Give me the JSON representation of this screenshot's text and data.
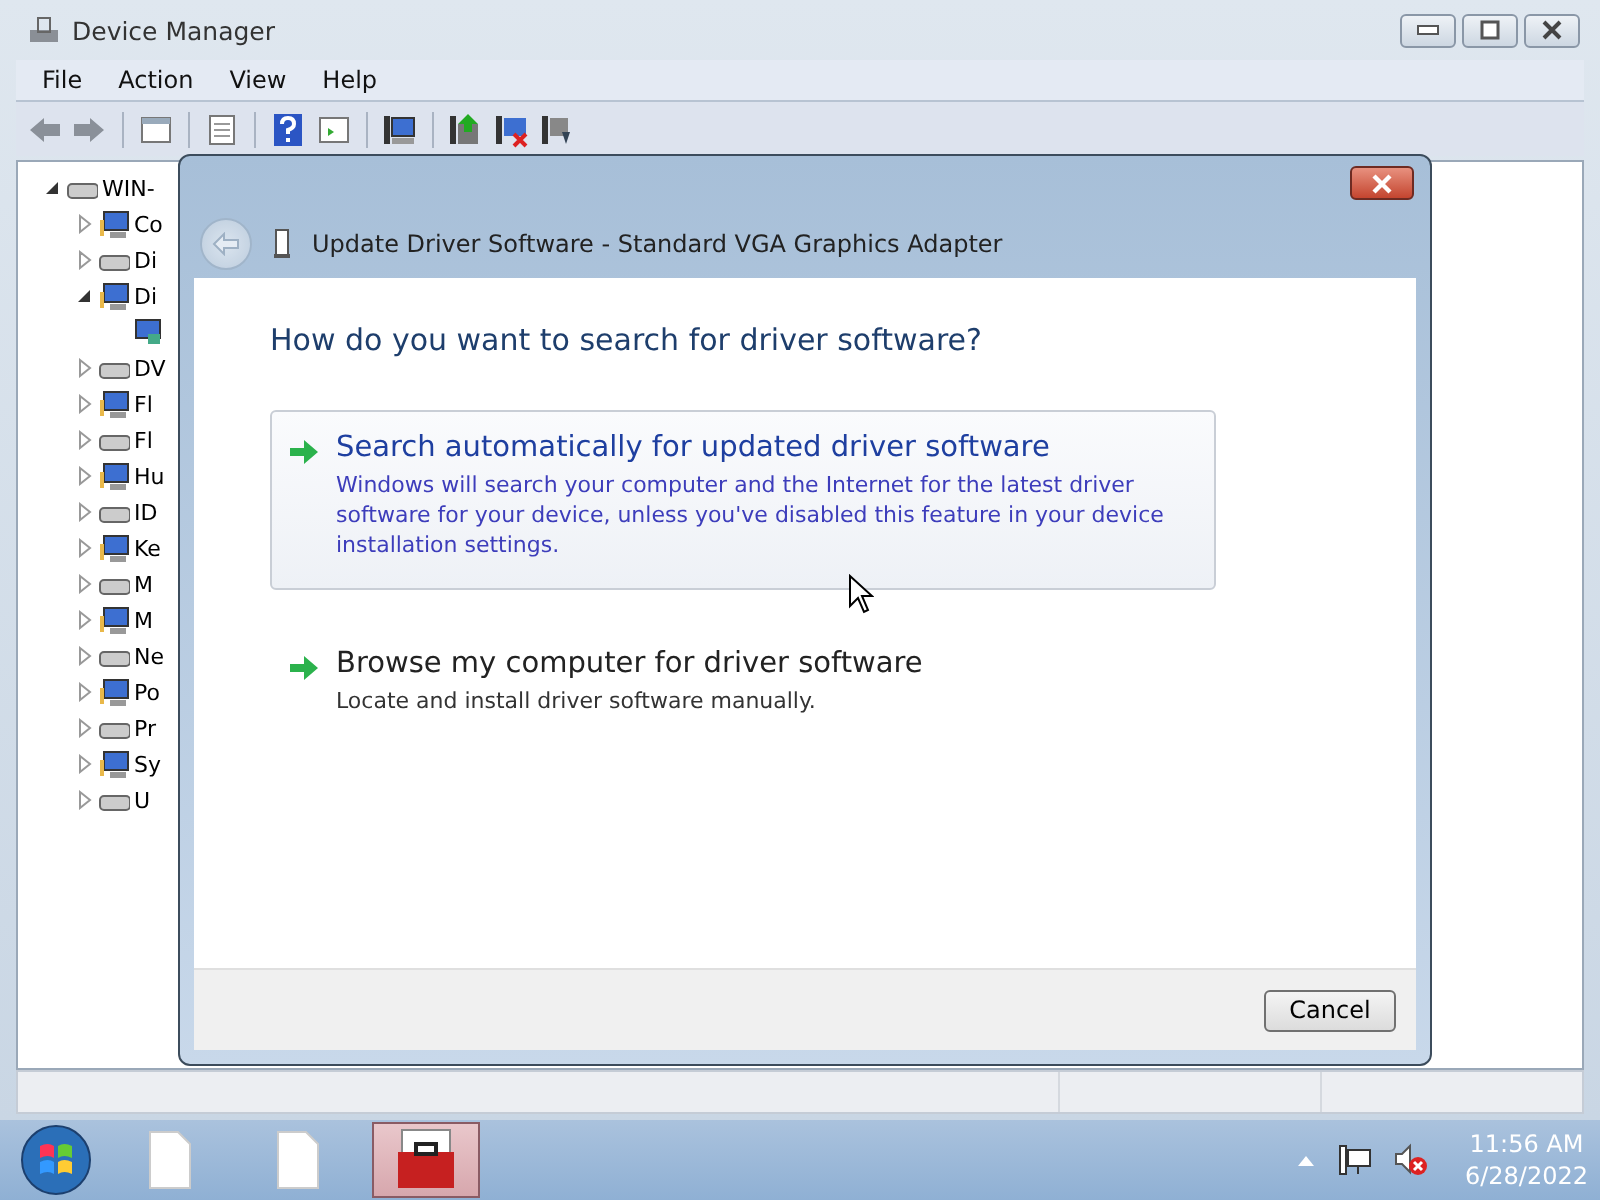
{
  "window": {
    "title": "Device Manager"
  },
  "menu": [
    "File",
    "Action",
    "View",
    "Help"
  ],
  "tree": {
    "label": "WIN-",
    "expanded": true,
    "children": [
      {
        "label": "Co",
        "expanded": false
      },
      {
        "label": "Di",
        "expanded": false
      },
      {
        "label": "Di",
        "expanded": true,
        "children": [
          {
            "kind": "display"
          }
        ]
      },
      {
        "label": "DV",
        "expanded": false
      },
      {
        "label": "Fl",
        "expanded": false
      },
      {
        "label": "Fl",
        "expanded": false
      },
      {
        "label": "Hu",
        "expanded": false
      },
      {
        "label": "ID",
        "expanded": false
      },
      {
        "label": "Ke",
        "expanded": false
      },
      {
        "label": "M",
        "expanded": false
      },
      {
        "label": "M",
        "expanded": false
      },
      {
        "label": "Ne",
        "expanded": false
      },
      {
        "label": "Po",
        "expanded": false
      },
      {
        "label": "Pr",
        "expanded": false
      },
      {
        "label": "Sy",
        "expanded": false
      },
      {
        "label": "U",
        "expanded": false
      }
    ]
  },
  "dialog": {
    "title": "Update Driver Software - Standard VGA Graphics Adapter",
    "back_disabled": true,
    "heading": "How do you want to search for driver software?",
    "options": [
      {
        "title": "Search automatically for updated driver software",
        "description": "Windows will search your computer and the Internet for the latest driver software for your device, unless you've disabled this feature in your device installation settings.",
        "highlighted": true
      },
      {
        "title": "Browse my computer for driver software",
        "description": "Locate and install driver software manually.",
        "highlighted": false
      }
    ],
    "buttons": [
      "Cancel"
    ]
  },
  "taskbar": {
    "items": [
      {
        "kind": "file",
        "active": false
      },
      {
        "kind": "file",
        "active": false
      },
      {
        "kind": "toolbox",
        "active": true
      }
    ],
    "time": "11:56 AM",
    "date": "6/28/2022"
  }
}
